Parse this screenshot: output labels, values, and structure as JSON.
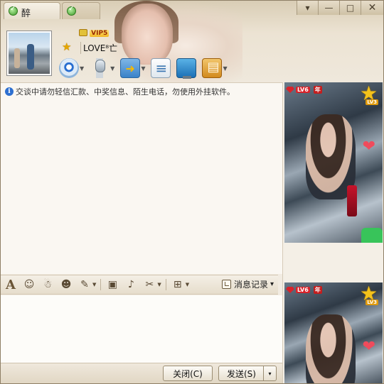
{
  "window": {
    "tabs": [
      {
        "label": "醉",
        "status": "online"
      },
      {
        "label": "",
        "status": "online"
      }
    ],
    "controls": {
      "menu": "▾",
      "minimize": "—",
      "maximize": "□",
      "close": "✕"
    }
  },
  "contact": {
    "vip_label": "VIP5",
    "nickname": "LOVE⁸亡",
    "star_icon": "star-icon"
  },
  "toolbar": {
    "buttons": [
      {
        "name": "webcam",
        "icon": "webcam-icon",
        "has_dropdown": true
      },
      {
        "name": "microphone",
        "icon": "microphone-icon",
        "has_dropdown": true
      },
      {
        "name": "send-file",
        "icon": "file-transfer-icon",
        "has_dropdown": true
      },
      {
        "name": "create-discussion",
        "icon": "discussion-icon",
        "has_dropdown": false
      },
      {
        "name": "remote-desktop",
        "icon": "remote-desktop-icon",
        "has_dropdown": false
      },
      {
        "name": "apps",
        "icon": "apps-icon",
        "has_dropdown": true
      }
    ]
  },
  "chat": {
    "notice": "交谈中请勿轻信汇款、中奖信息、陌生电话，勿使用外挂软件。"
  },
  "format_bar": {
    "font": "A",
    "history_label": "消息记录",
    "history_arrow": "▾"
  },
  "bottom": {
    "close_label": "关闭(C)",
    "send_label": "发送(S)",
    "send_arrow": "▾"
  },
  "video": {
    "level_label": "LV6",
    "year_label": "年",
    "star_level": "LV3"
  },
  "colors": {
    "accent": "#2d6fd0",
    "frame": "#8e7f66",
    "badge_red": "#d8232a",
    "online_green": "#3f9b2a"
  }
}
